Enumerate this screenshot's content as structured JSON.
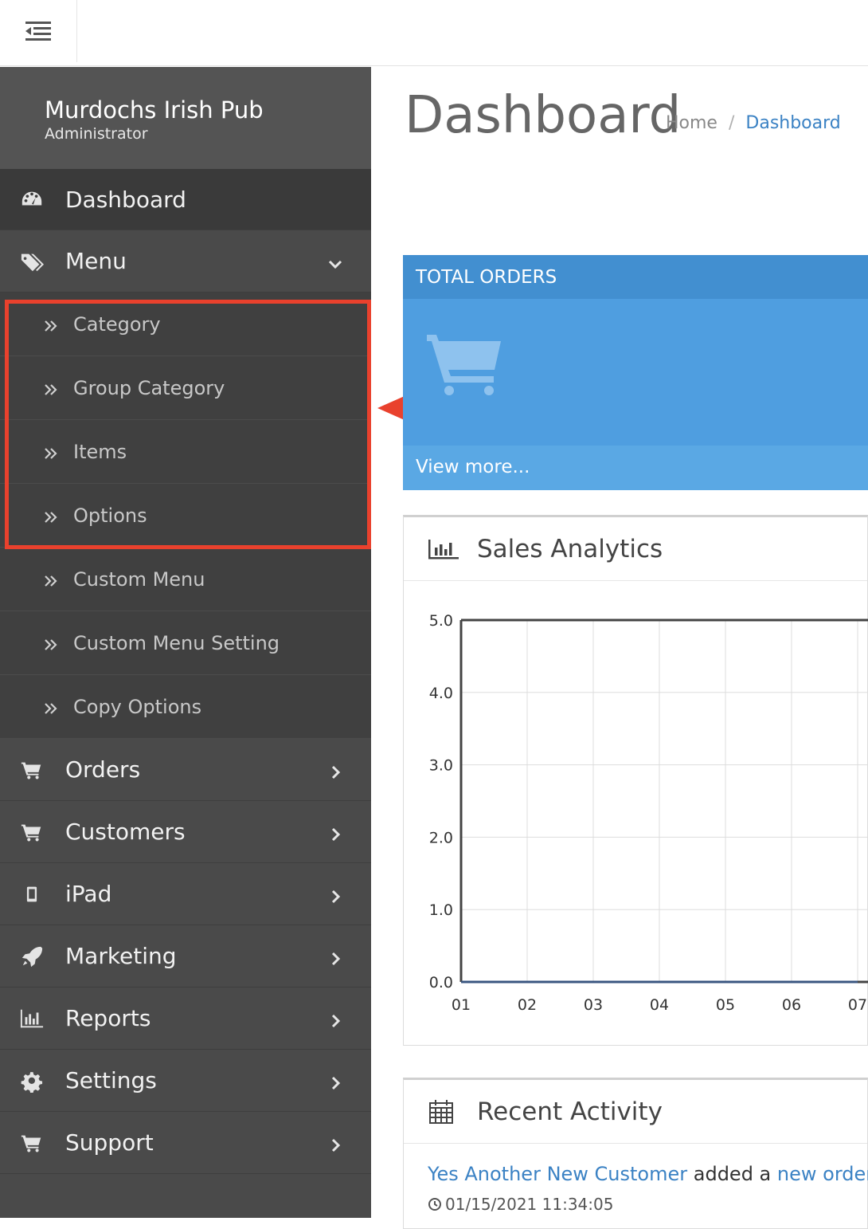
{
  "topbar": {
    "toggle_icon": "sidebar-collapse-icon"
  },
  "sidebar": {
    "brand_name": "Murdochs Irish Pub",
    "brand_role": "Administrator",
    "items": [
      {
        "label": "Dashboard",
        "icon": "dashboard-icon"
      },
      {
        "label": "Menu",
        "icon": "tags-icon"
      },
      {
        "label": "Orders",
        "icon": "cart-icon"
      },
      {
        "label": "Customers",
        "icon": "cart-icon"
      },
      {
        "label": "iPad",
        "icon": "tablet-icon"
      },
      {
        "label": "Marketing",
        "icon": "rocket-icon"
      },
      {
        "label": "Reports",
        "icon": "bar-chart-icon"
      },
      {
        "label": "Settings",
        "icon": "gear-icon"
      },
      {
        "label": "Support",
        "icon": "cart-icon"
      }
    ],
    "submenu": [
      "Category",
      "Group Category",
      "Items",
      "Options",
      "Custom Menu",
      "Custom Menu Setting",
      "Copy Options"
    ]
  },
  "header": {
    "title": "Dashboard",
    "breadcrumb_home": "Home",
    "breadcrumb_sep": "/",
    "breadcrumb_current": "Dashboard"
  },
  "orders_card": {
    "title": "TOTAL ORDERS",
    "link": "View more..."
  },
  "sales_panel": {
    "title": "Sales Analytics"
  },
  "activity_panel": {
    "title": "Recent Activity",
    "customer": "Yes Another New Customer",
    "action": " added a ",
    "object": "new order",
    "period": ".",
    "timestamp": "01/15/2021 11:34:05"
  },
  "colors": {
    "sidebar_bg": "#4a4a4a",
    "accent_blue": "#4f9ee0",
    "annotation_red": "#e9412d",
    "link_blue": "#3b82c4"
  },
  "chart_data": {
    "type": "line",
    "x": [
      "01",
      "02",
      "03",
      "04",
      "05",
      "06",
      "07"
    ],
    "series": [
      {
        "values": [
          0,
          0,
          0,
          0,
          0,
          0,
          0
        ]
      }
    ],
    "yticks": [
      "0.0",
      "1.0",
      "2.0",
      "3.0",
      "4.0",
      "5.0"
    ],
    "ylim": [
      0,
      5
    ],
    "grid": true,
    "title": "",
    "xlabel": "",
    "ylabel": ""
  }
}
